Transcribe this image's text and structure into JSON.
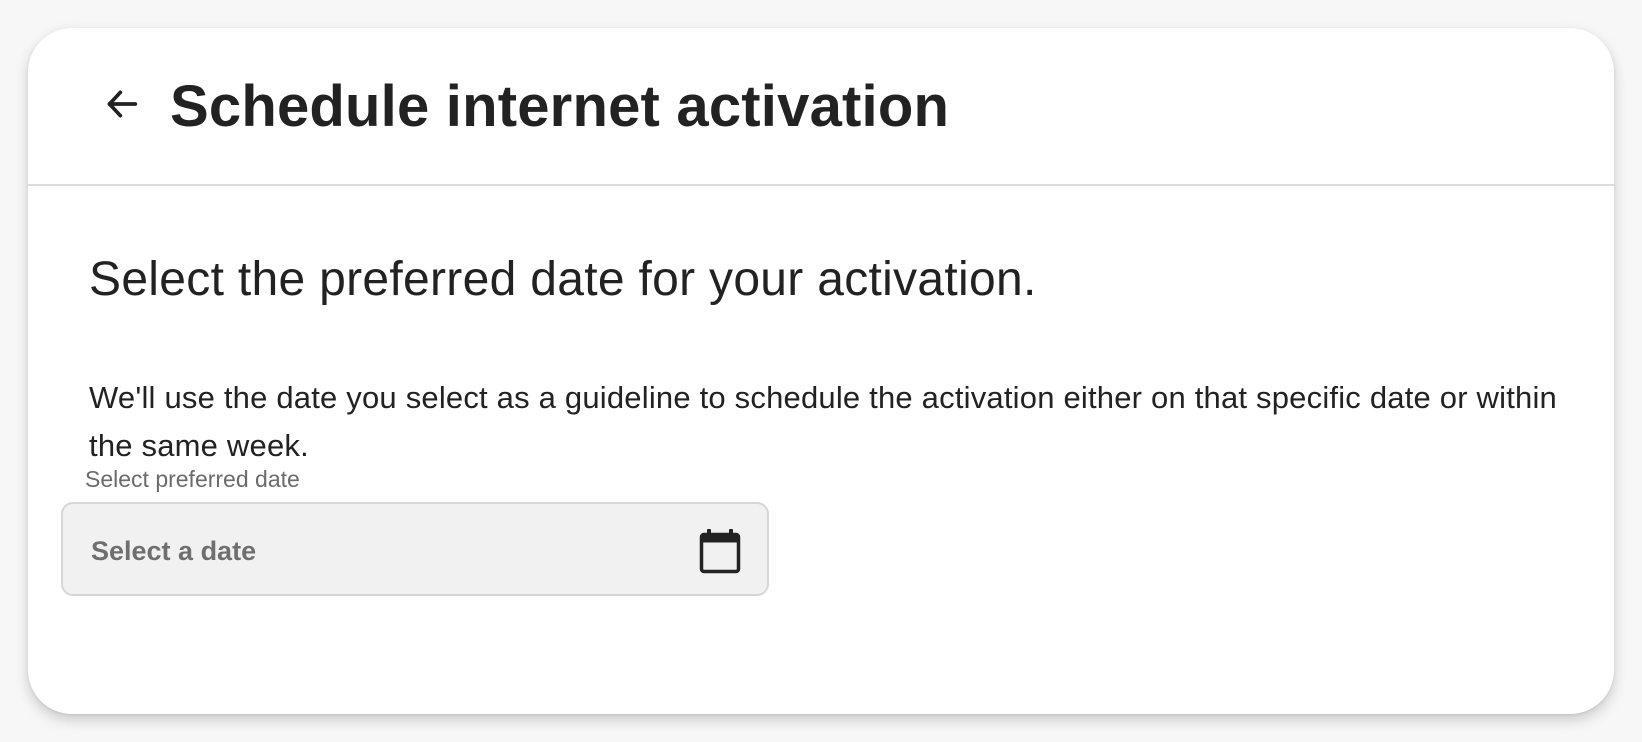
{
  "header": {
    "title": "Schedule internet activation",
    "back_icon": "arrow-left-icon"
  },
  "main": {
    "heading": "Select the preferred date for your activation.",
    "description": "We'll use the date you select as a guideline to schedule the activation either on that specific date or within the same week."
  },
  "date_field": {
    "label": "Select preferred date",
    "placeholder": "Select a date",
    "value": "",
    "icon": "calendar-icon"
  },
  "colors": {
    "text": "#222222",
    "muted_text": "#6b6b6b",
    "field_background": "#f1f1f1",
    "field_border": "#d6d6d6",
    "divider": "#dcdcdc"
  }
}
